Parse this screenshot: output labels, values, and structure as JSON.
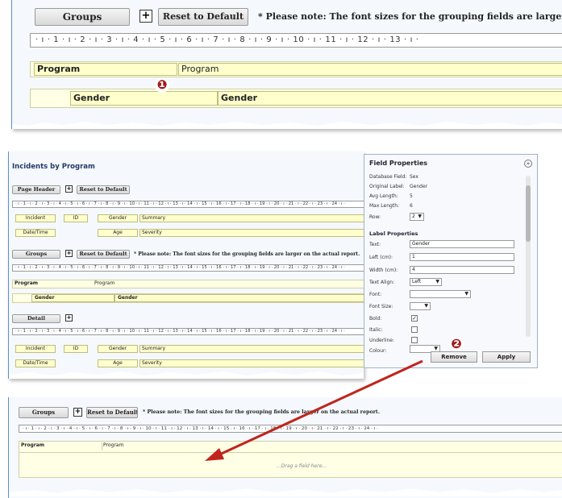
{
  "groups_button": "Groups",
  "reset_button": "Reset to Default",
  "plus_glyph": "+",
  "note": "* Please note: The font sizes for the grouping fields are larger on the actual report.",
  "note_short": "* Please note: The font sizes for the grouping fields are larger or",
  "ruler_numbers": [
    "1",
    "2",
    "3",
    "4",
    "5",
    "6",
    "7",
    "8",
    "9",
    "10",
    "11",
    "12",
    "13",
    "14",
    "15",
    "16",
    "17",
    "18",
    "19",
    "20",
    "21",
    "22",
    "23",
    "24"
  ],
  "top_panel": {
    "program_label": "Program",
    "program_value": "Program",
    "gender_label": "Gender",
    "gender_value": "Gender"
  },
  "middle_panel": {
    "title": "Incidents by Program",
    "page_header_button": "Page Header",
    "detail_button": "Detail",
    "row1": [
      "Incident",
      "ID",
      "Gender",
      "Summary"
    ],
    "row2": [
      "Date/Time",
      "Age",
      "Severity"
    ],
    "program_label": "Program",
    "program_value": "Program",
    "gender_label": "Gender",
    "gender_value": "Gender"
  },
  "field_properties": {
    "title": "Field Properties",
    "collapse_icon": "»",
    "info": [
      {
        "label": "Database Field:",
        "value": "Sex"
      },
      {
        "label": "Original Label:",
        "value": "Gender"
      },
      {
        "label": "Avg Length:",
        "value": "5"
      },
      {
        "label": "Max Length:",
        "value": "6"
      }
    ],
    "row_label": "Row:",
    "row_value": "2",
    "section": "Label Properties",
    "text_label": "Text:",
    "text_value": "Gender",
    "left_label": "Left (cm):",
    "left_value": "1",
    "width_label": "Width (cm):",
    "width_value": "4",
    "align_label": "Text Align:",
    "align_value": "Left",
    "font_label": "Font:",
    "font_size_label": "Font Size:",
    "bold_label": "Bold:",
    "bold_check": "✓",
    "italic_label": "Italic:",
    "underline_label": "Underline:",
    "colour_label": "Colour:",
    "remove_button": "Remove",
    "apply_button": "Apply",
    "dropdown_glyph": "▼"
  },
  "bottom_panel": {
    "program_label": "Program",
    "program_value": "Program",
    "drop_hint": "...Drag a field here..."
  },
  "badges": [
    "❶",
    "❷"
  ],
  "colors": {
    "field_fill": "#ffffcc",
    "badge": "#a11a1a",
    "arrow": "#c0241c",
    "panel_border": "#5a90c8"
  }
}
